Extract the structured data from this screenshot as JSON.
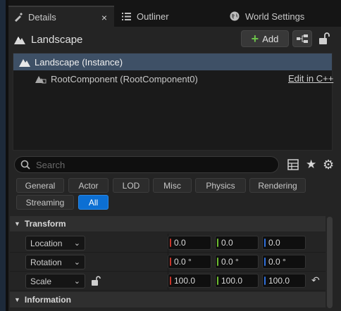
{
  "tabs": [
    {
      "label": "Details",
      "icon": "details-icon",
      "active": true
    },
    {
      "label": "Outliner",
      "icon": "outliner-icon",
      "active": false
    },
    {
      "label": "World Settings",
      "icon": "globe-icon",
      "active": false
    }
  ],
  "tab_close_glyph": "×",
  "header": {
    "title": "Landscape",
    "add_label": "Add",
    "add_glyph": "+"
  },
  "tree": {
    "selected_label": "Landscape (Instance)",
    "child_label": "RootComponent (RootComponent0)",
    "edit_link": "Edit in C++"
  },
  "search": {
    "placeholder": "Search",
    "value": ""
  },
  "icons": {
    "star": "★",
    "gear": "⚙"
  },
  "categories": [
    "General",
    "Actor",
    "LOD",
    "Misc",
    "Physics",
    "Rendering",
    "Streaming",
    "All"
  ],
  "active_category": "All",
  "sections": {
    "transform": "Transform",
    "information": "Information",
    "caret": "▼"
  },
  "transform": {
    "location": {
      "label": "Location",
      "x": "0.0",
      "y": "0.0",
      "z": "0.0"
    },
    "rotation": {
      "label": "Rotation",
      "x": "0.0 °",
      "y": "0.0 °",
      "z": "0.0 °"
    },
    "scale": {
      "label": "Scale",
      "x": "100.0",
      "y": "100.0",
      "z": "100.0"
    }
  },
  "dropdown_chevron": "⌄",
  "reset_glyph": "↶",
  "colors": {
    "accent": "#0c6fd3",
    "selection": "#3e5066",
    "axis_x": "#c9352b",
    "axis_y": "#6cba2f",
    "axis_z": "#2f6fdb",
    "add_plus": "#6cc24a"
  }
}
